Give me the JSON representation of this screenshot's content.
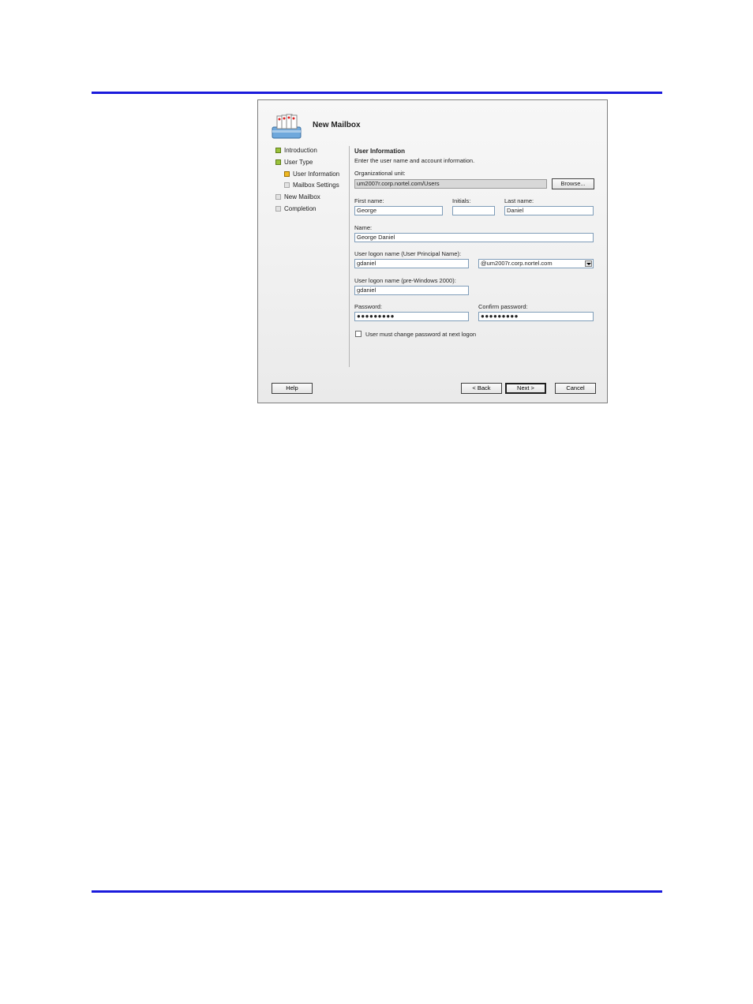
{
  "window": {
    "title": "New Mailbox"
  },
  "nav": {
    "items": [
      {
        "label": "Introduction",
        "state": "done"
      },
      {
        "label": "User Type",
        "state": "done"
      },
      {
        "label": "User Information",
        "state": "current"
      },
      {
        "label": "Mailbox Settings",
        "state": "todo"
      },
      {
        "label": "New Mailbox",
        "state": "todo"
      },
      {
        "label": "Completion",
        "state": "todo"
      }
    ]
  },
  "section": {
    "title": "User Information",
    "description": "Enter the user name and account information."
  },
  "form": {
    "org_unit_label": "Organizational unit:",
    "org_unit_value": "um2007r.corp.nortel.com/Users",
    "browse_label": "Browse...",
    "first_name_label": "First name:",
    "first_name_value": "George",
    "initials_label": "Initials:",
    "initials_value": "",
    "last_name_label": "Last name:",
    "last_name_value": "Daniel",
    "name_label": "Name:",
    "name_value": "George Daniel",
    "upn_label": "User logon name (User Principal Name):",
    "upn_value": "gdaniel",
    "upn_domain_value": "@um2007r.corp.nortel.com",
    "pre2000_label": "User logon name (pre-Windows 2000):",
    "pre2000_value": "gdaniel",
    "password_label": "Password:",
    "password_value": "●●●●●●●●●",
    "confirm_label": "Confirm password:",
    "confirm_value": "●●●●●●●●●",
    "must_change_label": "User must change password at next logon",
    "must_change_checked": false
  },
  "buttons": {
    "help": "Help",
    "back": "< Back",
    "next": "Next >",
    "cancel": "Cancel"
  },
  "colors": {
    "rule": "#1a1adc",
    "done": "#9ac23a",
    "current": "#f0b821"
  }
}
